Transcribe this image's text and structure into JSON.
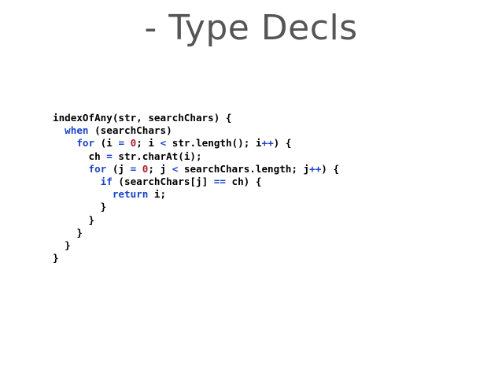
{
  "slide": {
    "title": "- Type Decls"
  },
  "code": {
    "lines": [
      {
        "indent": "",
        "segments": [
          {
            "t": "indexOfAny(str, searchChars) {",
            "k": "plain"
          }
        ]
      },
      {
        "indent": "  ",
        "segments": [
          {
            "t": "when",
            "k": "kw"
          },
          {
            "t": " (searchChars)",
            "k": "plain"
          }
        ]
      },
      {
        "indent": "    ",
        "segments": [
          {
            "t": "for",
            "k": "kw"
          },
          {
            "t": " (i ",
            "k": "plain"
          },
          {
            "t": "=",
            "k": "kw"
          },
          {
            "t": " ",
            "k": "plain"
          },
          {
            "t": "0",
            "k": "num"
          },
          {
            "t": "; i ",
            "k": "plain"
          },
          {
            "t": "<",
            "k": "kw"
          },
          {
            "t": " str.length(); i",
            "k": "plain"
          },
          {
            "t": "++",
            "k": "kw"
          },
          {
            "t": ") {",
            "k": "plain"
          }
        ]
      },
      {
        "indent": "      ",
        "segments": [
          {
            "t": "ch ",
            "k": "plain"
          },
          {
            "t": "=",
            "k": "kw"
          },
          {
            "t": " str.charAt(i);",
            "k": "plain"
          }
        ]
      },
      {
        "indent": "      ",
        "segments": [
          {
            "t": "for",
            "k": "kw"
          },
          {
            "t": " (j ",
            "k": "plain"
          },
          {
            "t": "=",
            "k": "kw"
          },
          {
            "t": " ",
            "k": "plain"
          },
          {
            "t": "0",
            "k": "num"
          },
          {
            "t": "; j ",
            "k": "plain"
          },
          {
            "t": "<",
            "k": "kw"
          },
          {
            "t": " searchChars.length; j",
            "k": "plain"
          },
          {
            "t": "++",
            "k": "kw"
          },
          {
            "t": ") {",
            "k": "plain"
          }
        ]
      },
      {
        "indent": "        ",
        "segments": [
          {
            "t": "if",
            "k": "kw"
          },
          {
            "t": " (searchChars[j] ",
            "k": "plain"
          },
          {
            "t": "==",
            "k": "kw"
          },
          {
            "t": " ch) {",
            "k": "plain"
          }
        ]
      },
      {
        "indent": "          ",
        "segments": [
          {
            "t": "return",
            "k": "kw"
          },
          {
            "t": " i;",
            "k": "plain"
          }
        ]
      },
      {
        "indent": "        ",
        "segments": [
          {
            "t": "}",
            "k": "plain"
          }
        ]
      },
      {
        "indent": "      ",
        "segments": [
          {
            "t": "}",
            "k": "plain"
          }
        ]
      },
      {
        "indent": "    ",
        "segments": [
          {
            "t": "}",
            "k": "plain"
          }
        ]
      },
      {
        "indent": "  ",
        "segments": [
          {
            "t": "}",
            "k": "plain"
          }
        ]
      },
      {
        "indent": "",
        "segments": [
          {
            "t": "}",
            "k": "plain"
          }
        ]
      }
    ]
  },
  "colors": {
    "title": "#555555",
    "keyword": "#1a44c8",
    "number": "#b21c2a",
    "text": "#000000",
    "background": "#ffffff"
  }
}
